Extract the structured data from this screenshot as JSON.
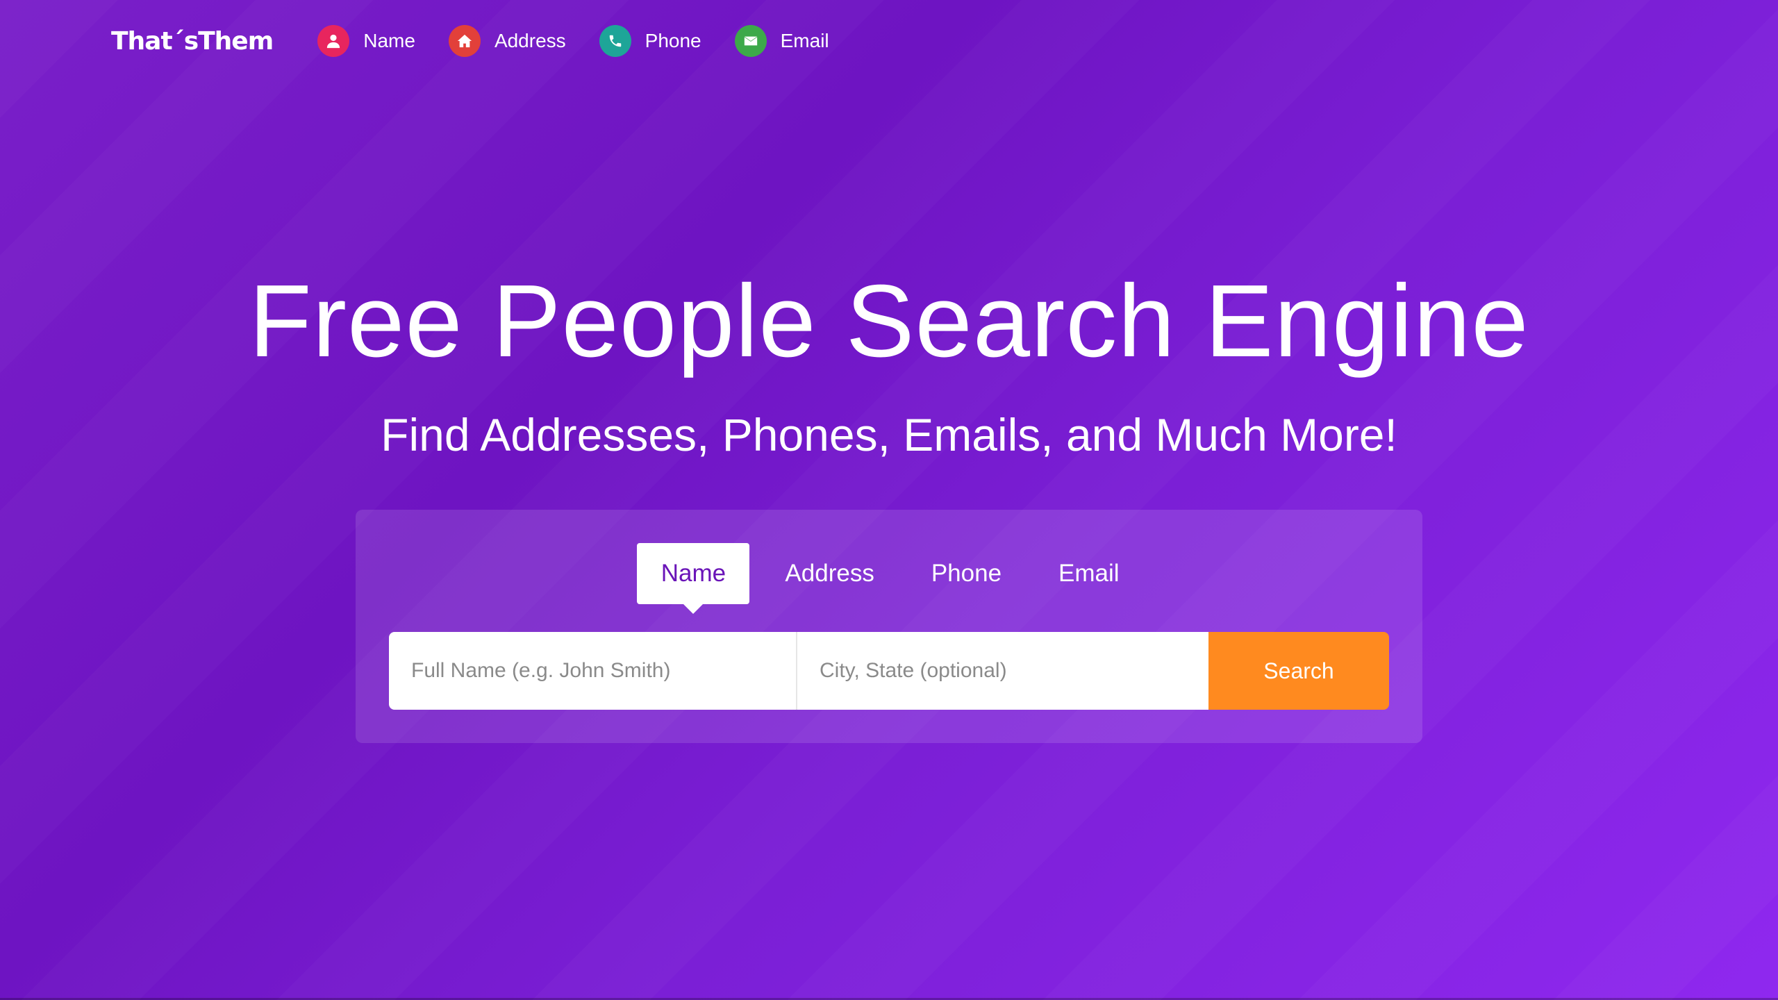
{
  "header": {
    "logo": "That´sThem",
    "nav": [
      {
        "label": "Name",
        "icon": "person-icon",
        "color": "#e8255e"
      },
      {
        "label": "Address",
        "icon": "home-icon",
        "color": "#e2403a"
      },
      {
        "label": "Phone",
        "icon": "phone-icon",
        "color": "#1ea598"
      },
      {
        "label": "Email",
        "icon": "envelope-icon",
        "color": "#3da94a"
      }
    ]
  },
  "hero": {
    "title": "Free People Search Engine",
    "subtitle": "Find Addresses, Phones, Emails, and Much More!"
  },
  "search": {
    "tabs": [
      "Name",
      "Address",
      "Phone",
      "Email"
    ],
    "active_tab": "Name",
    "name_placeholder": "Full Name (e.g. John Smith)",
    "city_placeholder": "City, State (optional)",
    "button_label": "Search",
    "button_color": "#ff8a1f"
  }
}
